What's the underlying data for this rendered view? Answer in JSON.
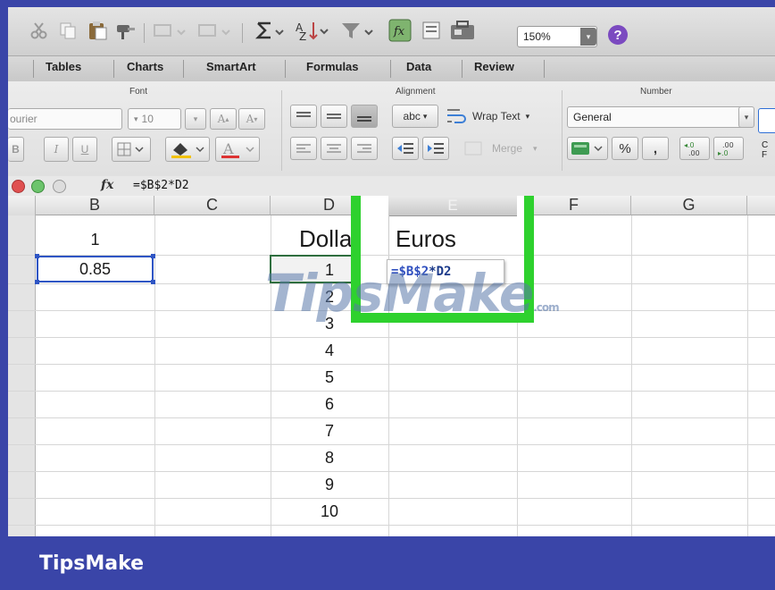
{
  "toolbar": {
    "zoom": "150%",
    "zoom_arrow": "▾",
    "help": "?",
    "icons": [
      "cut-icon",
      "copy-icon",
      "paste-icon",
      "format-painter-icon",
      "undo-icon",
      "redo-icon",
      "autosum-icon",
      "sort-icon",
      "filter-icon",
      "function-icon",
      "gallery-icon",
      "toolbox-icon",
      "help-icon"
    ]
  },
  "tabs": [
    "Tables",
    "Charts",
    "SmartArt",
    "Formulas",
    "Data",
    "Review"
  ],
  "ribbon": {
    "font_group": "Font",
    "alignment_group": "Alignment",
    "number_group": "Number",
    "font_name": "ourier",
    "font_size": "10",
    "wrap_text": "Wrap Text",
    "merge": "Merge",
    "number_format": "General",
    "percent": "%",
    "comma": ",",
    "abc": "abc",
    "cf_label_1": "C",
    "cf_label_2": "F"
  },
  "formula_bar": {
    "fx": "fx",
    "formula": "=$B$2*D2"
  },
  "sheet": {
    "columns": [
      "B",
      "C",
      "D",
      "E",
      "F",
      "G"
    ],
    "b_values": [
      "1",
      "0.85"
    ],
    "d_header": "Dollar",
    "e_header": "Euros",
    "dollars": [
      "1",
      "2",
      "3",
      "4",
      "5",
      "6",
      "7",
      "8",
      "9",
      "10"
    ],
    "edit_part1": "=",
    "edit_ref": "$B$2",
    "edit_part2": "*D2"
  },
  "watermark": {
    "text": "TipsMake",
    "suffix": ".com"
  },
  "footer": {
    "brand": "TipsMake"
  },
  "colors": {
    "highlight": "#2ed12e",
    "selection": "#2f55c4",
    "background": "#3a45a8"
  }
}
